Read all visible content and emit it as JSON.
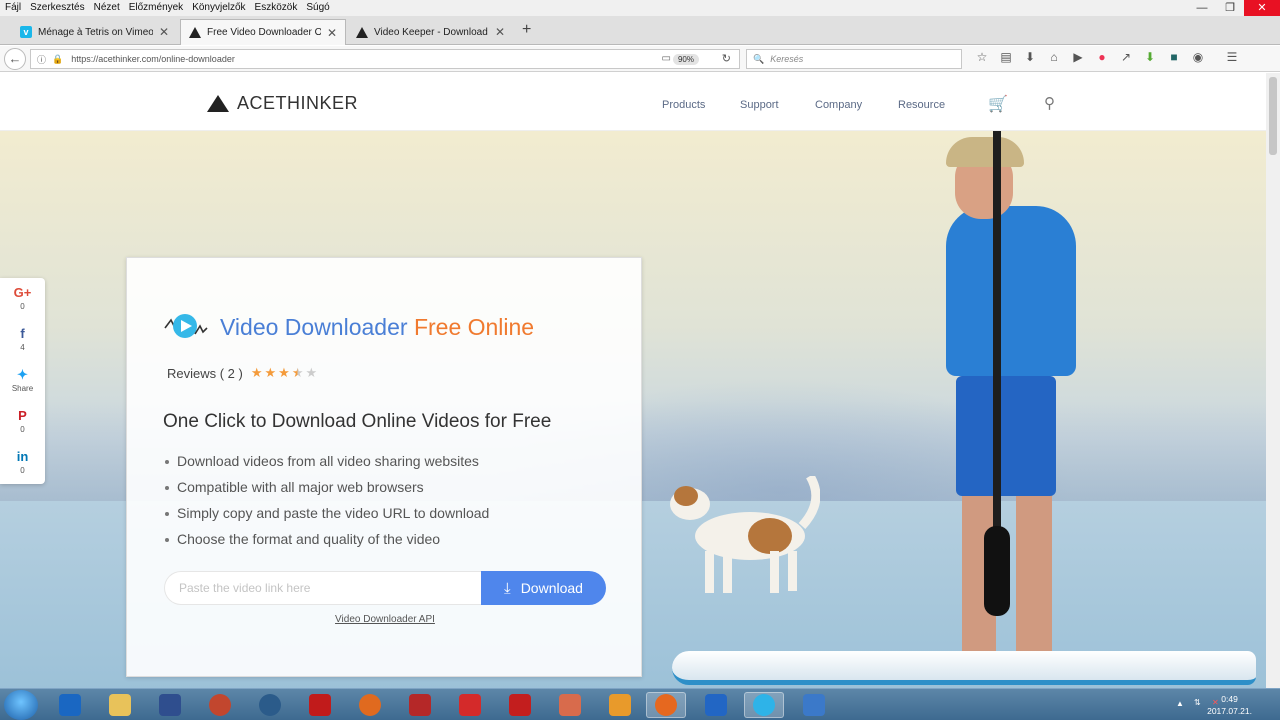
{
  "menu": [
    "Fájl",
    "Szerkesztés",
    "Nézet",
    "Előzmények",
    "Könyvjelzők",
    "Eszközök",
    "Súgó"
  ],
  "window_controls": {
    "minimize": "—",
    "restore": "❐",
    "close": "✕"
  },
  "tabs": [
    {
      "title": "Ménage à Tetris on Vimeo",
      "favicon": "vimeo-icon",
      "close": "✕"
    },
    {
      "title": "Free Video Downloader Onli",
      "favicon": "acethinker-icon",
      "close": "✕"
    },
    {
      "title": "Video Keeper - Download ar",
      "favicon": "acethinker-icon",
      "close": "✕"
    }
  ],
  "newtab": "+",
  "address": {
    "url": "https://acethinker.com/online-downloader",
    "zoom": "90%"
  },
  "search": {
    "placeholder": "Keresés"
  },
  "site": {
    "logo": "ACETHINKER",
    "nav": [
      "Products",
      "Support",
      "Company",
      "Resource"
    ]
  },
  "product": {
    "title_part1": "Video Downloader",
    "title_part2": "Free Online",
    "reviews_label": "Reviews ( 2 )",
    "rating": 3.5,
    "rating_max": 5,
    "headline": "One Click to Download Online Videos for Free",
    "features": [
      "Download videos from all video sharing websites",
      "Compatible with all major web browsers",
      "Simply copy and paste the video URL to download",
      "Choose the format and quality of the video"
    ],
    "input_placeholder": "Paste the video link here",
    "download_label": "Download",
    "api_link": "Video Downloader API"
  },
  "share": [
    {
      "icon": "google-plus-icon",
      "glyph": "G+",
      "count": "0",
      "color": "#dd4b39"
    },
    {
      "icon": "facebook-icon",
      "glyph": "f",
      "count": "4",
      "color": "#3b5998"
    },
    {
      "icon": "twitter-icon",
      "glyph": "🐦",
      "count": "Share",
      "color": "#1da1f2"
    },
    {
      "icon": "pinterest-icon",
      "glyph": "P",
      "count": "0",
      "color": "#cb2027"
    },
    {
      "icon": "linkedin-icon",
      "glyph": "in",
      "count": "0",
      "color": "#0077b5"
    }
  ],
  "clock": {
    "time": "0:49",
    "date": "2017.07.21."
  }
}
